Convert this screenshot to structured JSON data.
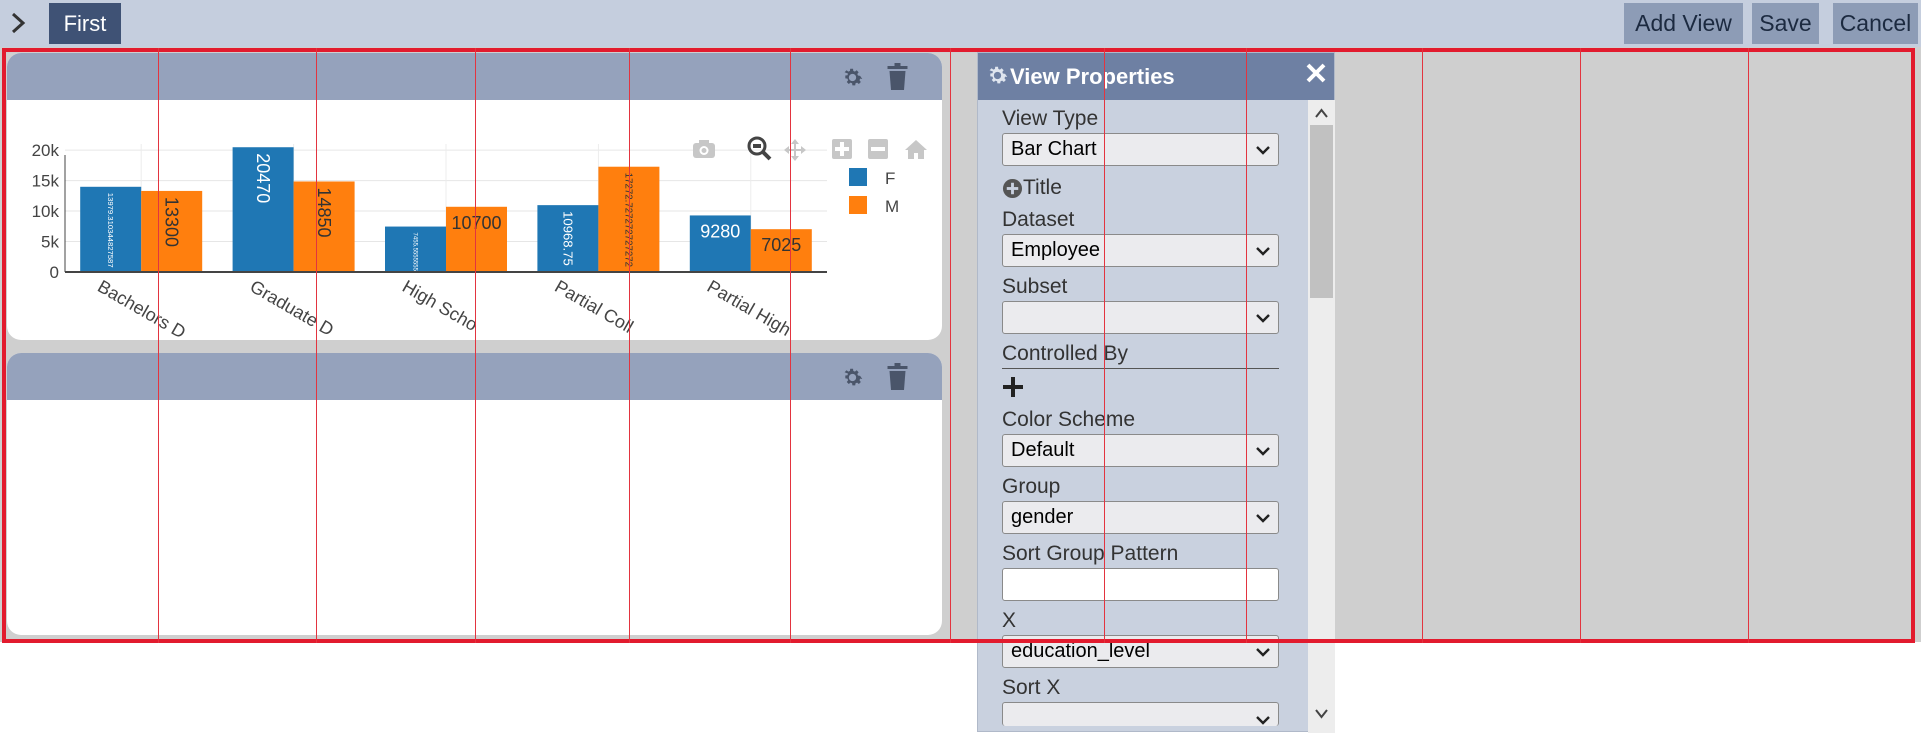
{
  "topbar": {
    "tab_label": "First",
    "add_view_label": "Add View",
    "save_label": "Save",
    "cancel_label": "Cancel"
  },
  "colors": {
    "female": "#1f77b4",
    "male": "#ff7f0e",
    "accent": "#3f5275",
    "overlay": "#e21b2e"
  },
  "chart_data": {
    "type": "bar",
    "categories": [
      "Bachelors D",
      "Graduate D",
      "High Scho",
      "Partial Coll",
      "Partial High"
    ],
    "series": [
      {
        "name": "F",
        "values": [
          13979.310344827587,
          20470,
          7455.555555555556,
          10968.75,
          9280
        ],
        "labels": [
          "13979.310344827587",
          "20470",
          "7455.555555555556",
          "10968.75",
          "9280"
        ]
      },
      {
        "name": "M",
        "values": [
          13300,
          14850,
          10700,
          17272.727272727272,
          7025
        ],
        "labels": [
          "13300",
          "14850",
          "10700",
          "17272.727272727272",
          "7025"
        ]
      }
    ],
    "yticks": [
      "0",
      "5k",
      "10k",
      "15k",
      "20k"
    ],
    "ylim": [
      0,
      21000
    ],
    "legend_position": "top-right",
    "grid": true
  },
  "modebar": [
    "camera-icon",
    "zoom-icon",
    "pan-icon",
    "zoom-in-icon",
    "zoom-out-icon",
    "home-icon"
  ],
  "properties": {
    "title": "View Properties",
    "view_type_label": "View Type",
    "view_type_value": "Bar Chart",
    "title_toggle_label": "Title",
    "dataset_label": "Dataset",
    "dataset_value": "Employee",
    "subset_label": "Subset",
    "subset_value": "",
    "controlled_by_label": "Controlled By",
    "color_scheme_label": "Color Scheme",
    "color_scheme_value": "Default",
    "group_label": "Group",
    "group_value": "gender",
    "sort_group_label": "Sort Group Pattern",
    "sort_group_value": "",
    "x_label": "X",
    "x_value": "education_level",
    "sort_x_label": "Sort X",
    "sort_x_value": ""
  }
}
